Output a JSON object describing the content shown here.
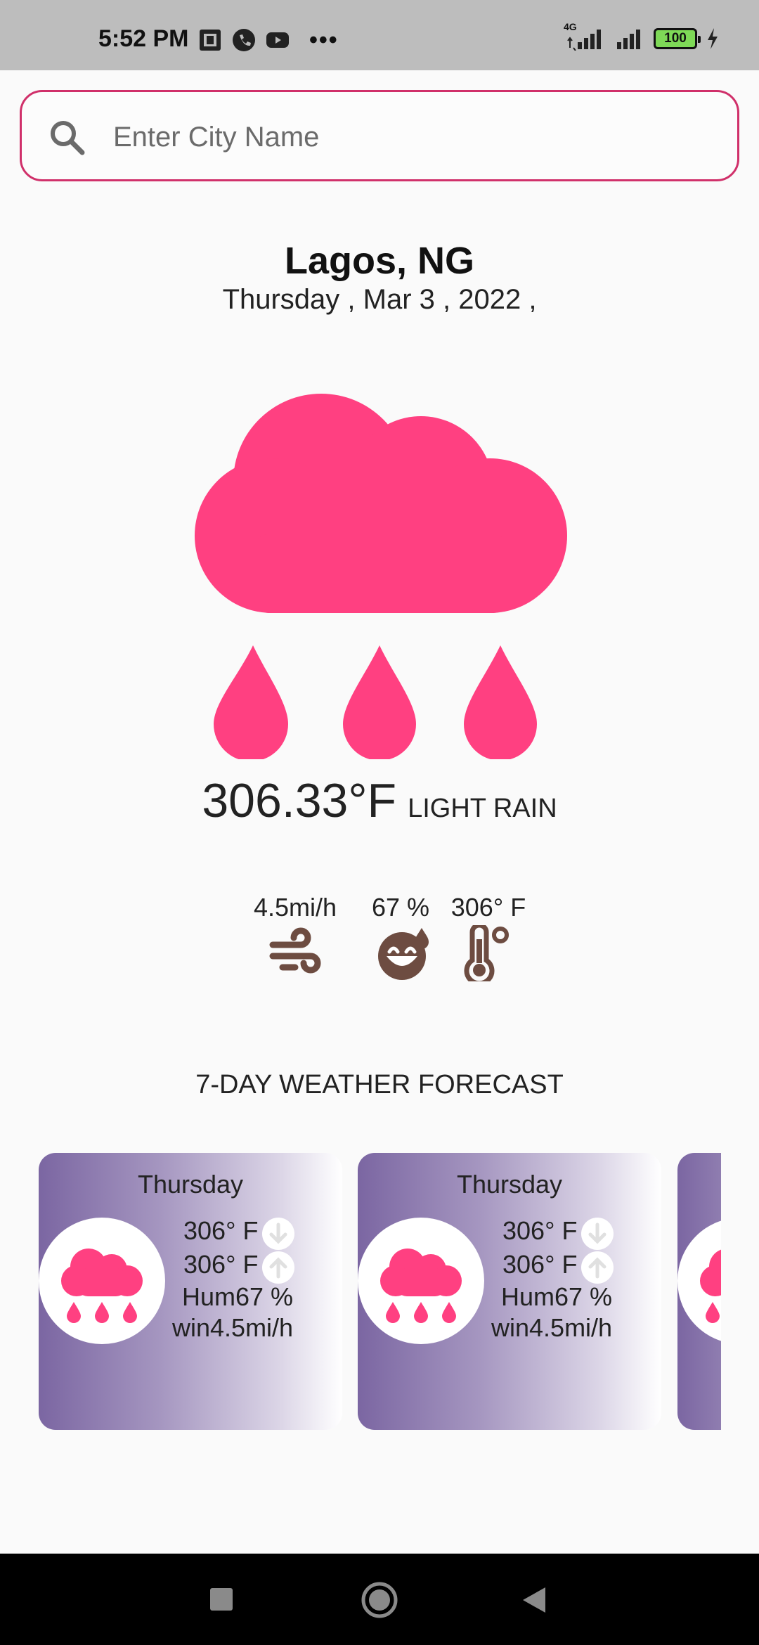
{
  "status_bar": {
    "time": "5:52 PM",
    "icons_left": [
      "nfc-icon",
      "phone-icon",
      "youtube-icon"
    ],
    "more": "•••",
    "network_label": "4G",
    "battery": "100"
  },
  "search": {
    "placeholder": "Enter City Name",
    "value": ""
  },
  "location": {
    "city": "Lagos, NG",
    "date": "Thursday , Mar 3 , 2022 ,"
  },
  "current": {
    "temperature": "306.33°F",
    "condition": "LIGHT RAIN",
    "icon": "cloud-rain-icon"
  },
  "stats": {
    "wind": "4.5mi/h",
    "humidity": "67 %",
    "feels_like": "306° F"
  },
  "forecast": {
    "title": "7-DAY WEATHER FORECAST",
    "days": [
      {
        "day": "Thursday",
        "min": "306° F",
        "max": "306° F",
        "hum": "Hum67 %",
        "wind": "win4.5mi/h"
      },
      {
        "day": "Thursday",
        "min": "306° F",
        "max": "306° F",
        "hum": "Hum67 %",
        "wind": "win4.5mi/h"
      }
    ]
  },
  "colors": {
    "accent": "#ff4081",
    "search_border": "#d0306a",
    "stat_icon": "#6d4c41",
    "card_gradient_start": "#7b66a2"
  }
}
